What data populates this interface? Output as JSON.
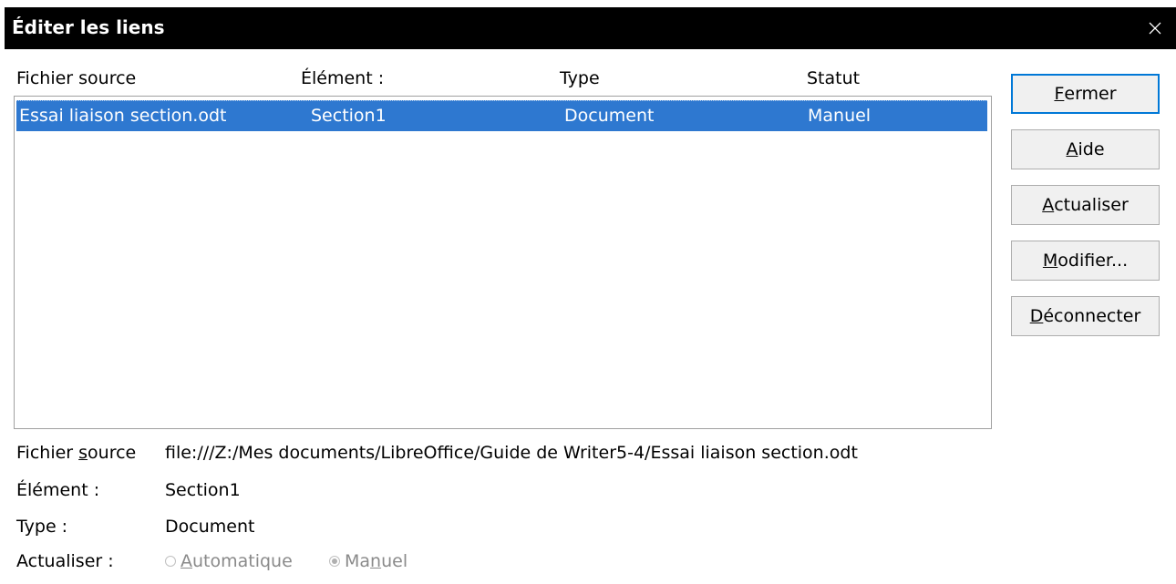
{
  "window": {
    "title": "Éditer les liens",
    "close_icon": "close-icon"
  },
  "list": {
    "headers": [
      "Fichier source",
      "Élément :",
      "Type",
      "Statut"
    ],
    "rows": [
      {
        "source": "Essai liaison section.odt",
        "element": "Section1",
        "type": "Document",
        "status": "Manuel",
        "selected": true
      }
    ]
  },
  "buttons": {
    "close": {
      "pre": "",
      "key": "F",
      "post": "ermer"
    },
    "help": {
      "pre": "",
      "key": "A",
      "post": "ide"
    },
    "update": {
      "pre": "",
      "key": "A",
      "post": "ctualiser"
    },
    "modify": {
      "pre": "",
      "key": "M",
      "post": "odifier..."
    },
    "disconnect": {
      "pre": "",
      "key": "D",
      "post": "éconnecter"
    }
  },
  "details": {
    "source_label_pre": "Fichier ",
    "source_label_key": "s",
    "source_label_post": "ource",
    "source_value": "file:///Z:/Mes documents/LibreOffice/Guide de Writer5-4/Essai liaison section.odt",
    "element_label": "Élément :",
    "element_value": "Section1",
    "type_label": "Type :",
    "type_value": "Document",
    "update_label": "Actualiser :",
    "auto": {
      "pre": "",
      "key": "A",
      "post": "utomatique",
      "checked": false
    },
    "manual": {
      "pre": "Ma",
      "key": "n",
      "post": "uel",
      "checked": true
    }
  },
  "colors": {
    "titlebar": "#000000",
    "selection": "#2e78d0",
    "default_button_border": "#0078d7",
    "disabled_text": "#8a8a8a"
  }
}
